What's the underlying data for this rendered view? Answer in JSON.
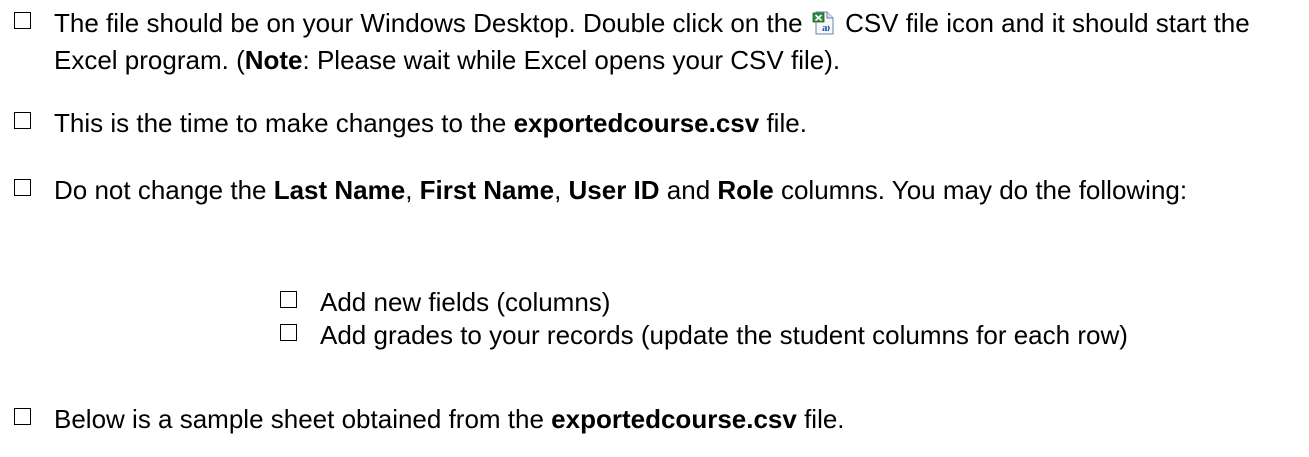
{
  "items": [
    {
      "part1": "The file should be on your Windows Desktop.  Double click on the ",
      "part2": " CSV file icon and it should start the Excel program. (",
      "note_label": "Note",
      "part3": ": Please wait while Excel opens your CSV file)."
    },
    {
      "part1": "This is the time to make changes to the ",
      "filename": "exportedcourse.csv",
      "part2": " file."
    },
    {
      "part1": "Do not change the ",
      "col1": "Last Name",
      "sep1": ", ",
      "col2": "First Name",
      "sep2": ", ",
      "col3": "User ID",
      "sep3": " and ",
      "col4": "Role",
      "part2": " columns.  You may do the following:"
    },
    {
      "sub_items": [
        "Add new fields (columns)",
        "Add grades to your records (update the student columns for each row)"
      ]
    },
    {
      "part1": "Below is a sample sheet obtained from the ",
      "filename": "exportedcourse.csv",
      "part2": " file."
    }
  ],
  "icons": {
    "csv_file": "excel-csv-file-icon"
  }
}
